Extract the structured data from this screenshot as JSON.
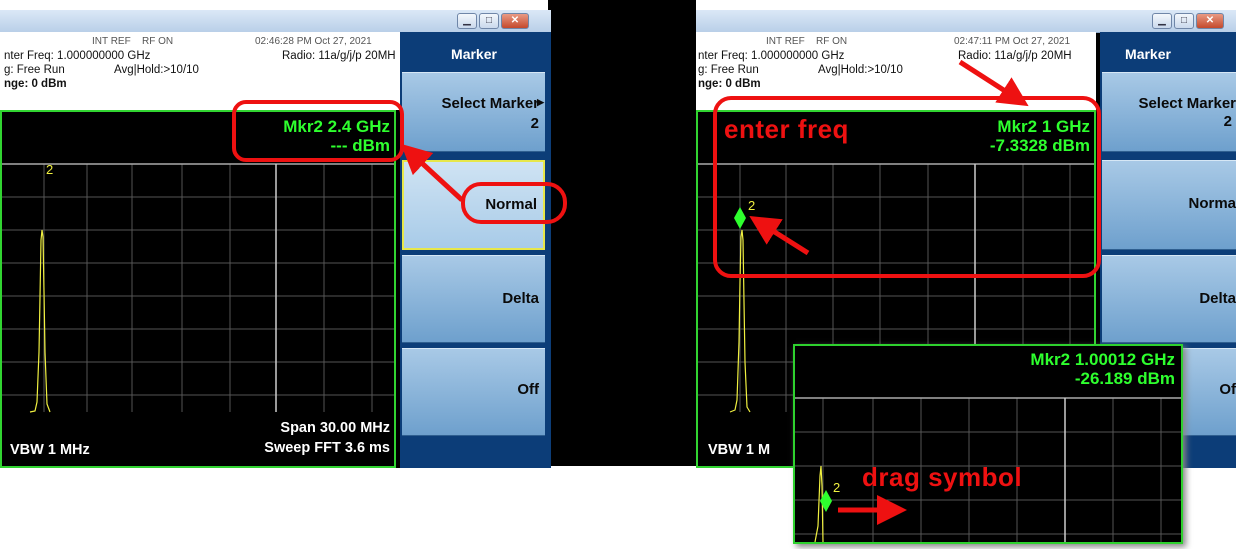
{
  "left": {
    "status": {
      "int_ref": "INT REF",
      "rf_on": "RF ON",
      "timestamp": "02:46:28 PM Oct 27, 2021",
      "center_freq": "nter Freq: 1.000000000 GHz",
      "radio": "Radio: 11a/g/j/p 20MH",
      "trig": "g: Free Run",
      "avg_hold": "Avg|Hold:>10/10",
      "ref_level": "nge: 0 dBm"
    },
    "marker_readout": {
      "freq": "Mkr2  2.4 GHz",
      "amp": "--- dBm"
    },
    "marker_number": "2",
    "footer": {
      "vbw": "VBW  1 MHz",
      "span": "Span 30.00 MHz",
      "sweep": "Sweep FFT  3.6 ms"
    },
    "menu": {
      "title": "Marker",
      "select_marker": "Select Marker",
      "select_marker_value": "2",
      "normal": "Normal",
      "delta": "Delta",
      "off": "Off"
    }
  },
  "right": {
    "status": {
      "int_ref": "INT REF",
      "rf_on": "RF ON",
      "timestamp": "02:47:11 PM Oct 27, 2021",
      "center_freq": "nter Freq: 1.000000000 GHz",
      "radio": "Radio: 11a/g/j/p 20MH",
      "trig": "g: Free Run",
      "avg_hold": "Avg|Hold:>10/10",
      "ref_level": "nge: 0 dBm"
    },
    "marker_readout": {
      "freq": "Mkr2  1 GHz",
      "amp": "-7.3328 dBm"
    },
    "marker_number": "2",
    "footer": {
      "vbw": "VBW  1 M"
    },
    "menu": {
      "title": "Marker",
      "select_marker": "Select Marker",
      "select_marker_value": "2",
      "normal": "Norma",
      "delta": "Delta",
      "off": "Of"
    }
  },
  "inset": {
    "marker_readout": {
      "freq": "Mkr2  1.00012 GHz",
      "amp": "-26.189 dBm"
    },
    "marker_number": "2"
  },
  "annotations": {
    "enter_freq": "enter freq",
    "drag_symbol": "drag symbol"
  },
  "colors": {
    "annotation_red": "#ee1111",
    "marker_green": "#2eff2e",
    "trace_yellow": "#f0f040",
    "menu_blue": "#0c3d78"
  }
}
